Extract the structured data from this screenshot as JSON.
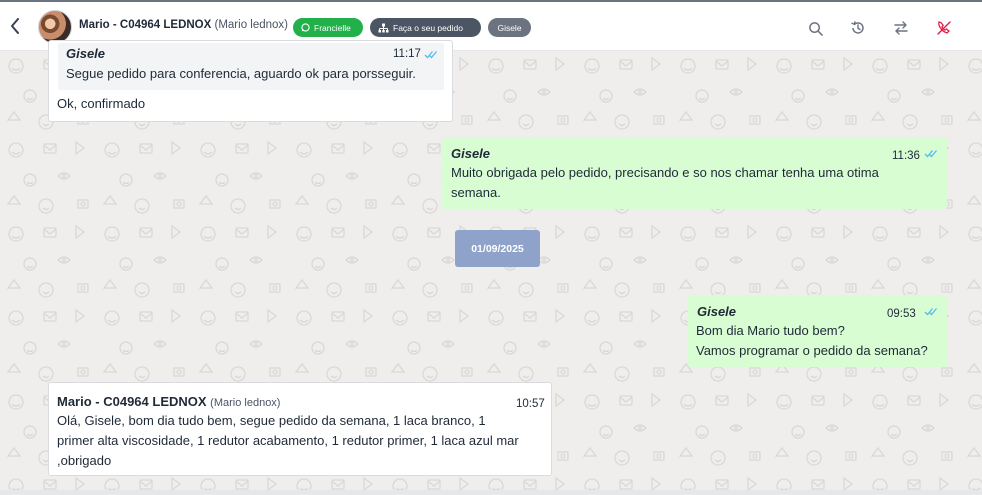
{
  "header": {
    "contact_name": "Mario - C04964 LEDNOX",
    "contact_subtitle": "(Mario lednox)",
    "tags": [
      {
        "label": "Francielle",
        "color": "#22b04b",
        "icon": "whatsapp-icon"
      },
      {
        "label": "Faça o seu pedido",
        "color": "#4b5563",
        "icon": "flow-icon"
      },
      {
        "label": "Gisele",
        "color": "#6b7280"
      }
    ],
    "icons": [
      "back-icon",
      "search-icon",
      "history-icon",
      "transfer-icon",
      "end-call-icon"
    ]
  },
  "messages": [
    {
      "direction": "incoming",
      "quote": {
        "sender": "Gisele",
        "time": "11:17",
        "text": "Segue pedido para conferencia, aguardo ok para porsseguir."
      },
      "text": "Ok, confirmado"
    },
    {
      "direction": "outgoing",
      "sender": "Gisele",
      "time": "11:36",
      "lines": [
        "Muito obrigada pelo pedido, precisando e so nos chamar tenha uma otima",
        "semana."
      ]
    },
    {
      "direction": "date-separator",
      "text": "01/09/2025"
    },
    {
      "direction": "outgoing",
      "sender": "Gisele",
      "time": "09:53",
      "lines": [
        "Bom dia Mario tudo bem?",
        "Vamos programar o pedido da semana?"
      ]
    },
    {
      "direction": "incoming",
      "sender": "Mario - C04964 LEDNOX",
      "sender_sub": "(Mario lednox)",
      "time": "10:57",
      "lines": [
        "Olá, Gisele, bom dia tudo bem, segue pedido da semana, 1 laca branco, 1",
        "primer alta viscosidade, 1 redutor acabamento, 1 redutor primer, 1 laca azul mar",
        ",obrigado"
      ]
    }
  ],
  "colors": {
    "incoming_bg": "#ffffff",
    "outgoing_bg": "#d9fdd3",
    "date_pill": "#8fa2c9",
    "read_ticks": "#53bdeb",
    "end_call": "#e11d48"
  }
}
